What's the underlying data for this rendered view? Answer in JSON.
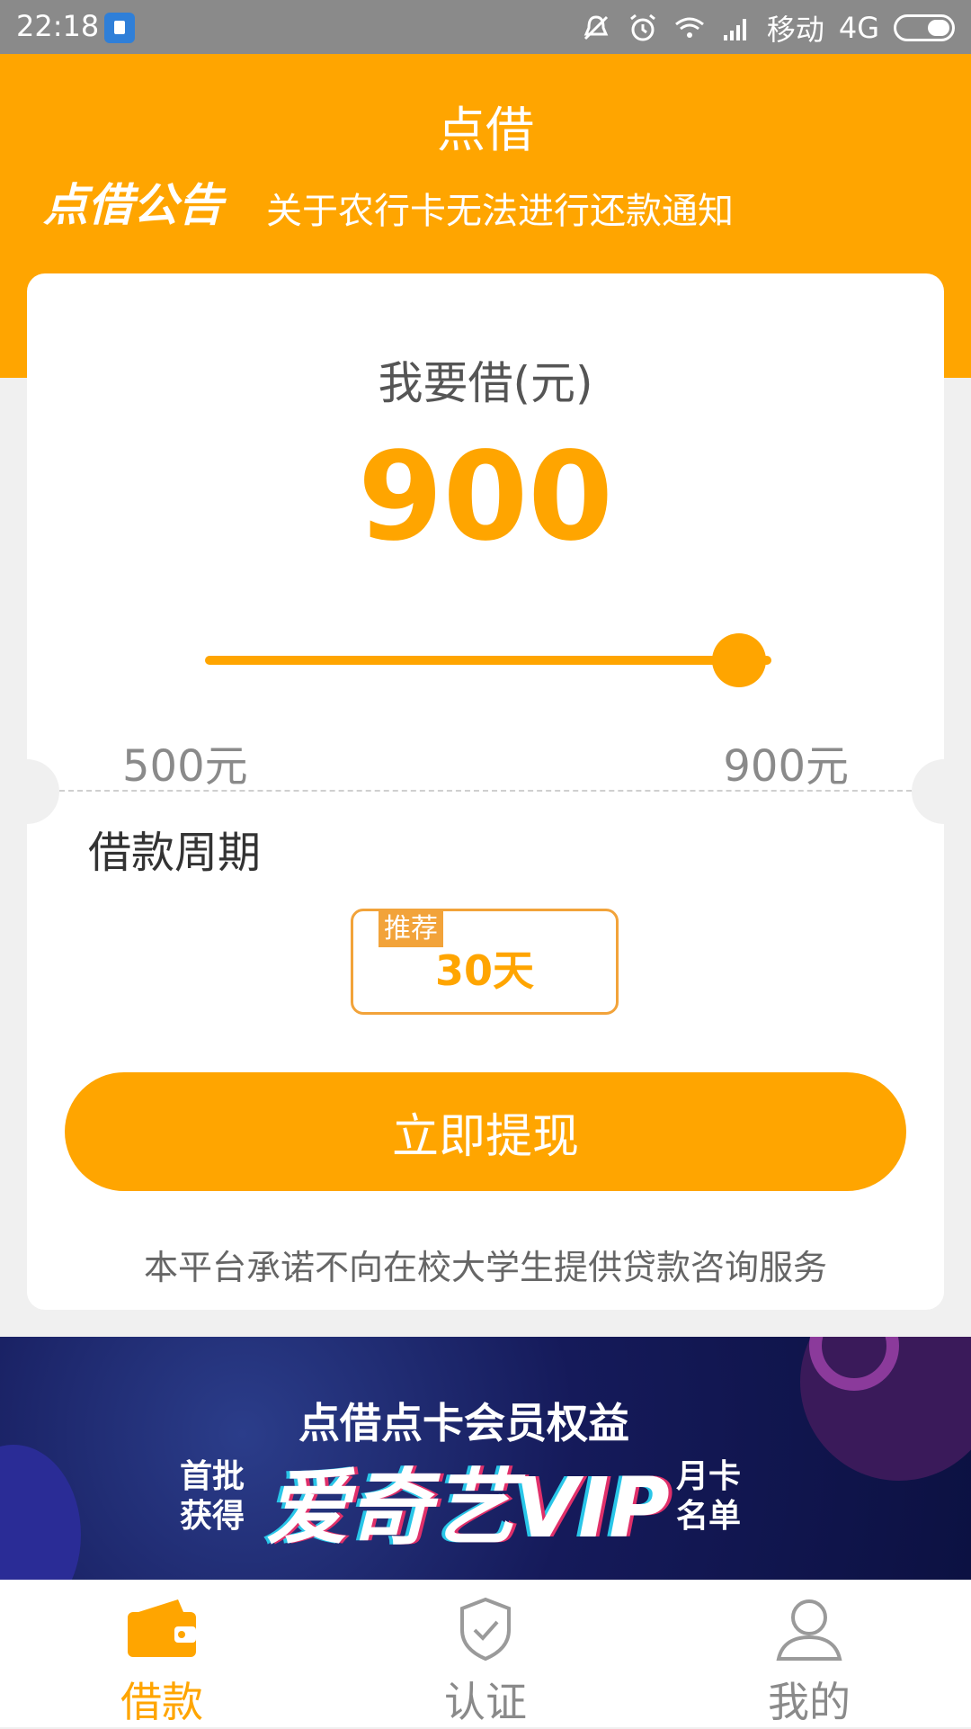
{
  "status_bar": {
    "time": "22:18",
    "carrier": "移动",
    "network": "4G",
    "icons": [
      "app-notification-icon",
      "mute-icon",
      "alarm-icon",
      "wifi-icon",
      "signal-icon",
      "battery-icon"
    ]
  },
  "header": {
    "title": "点借",
    "notice_label": "点借公告",
    "notice_text": "关于农行卡无法进行还款通知",
    "background_color": "#ffa500"
  },
  "loan_card": {
    "amount_label": "我要借(元)",
    "amount_value": "900",
    "slider": {
      "min_label": "500元",
      "max_label": "900元",
      "value_fraction": 1.0
    },
    "period_label": "借款周期",
    "period_option": {
      "tag": "推荐",
      "value": "30天"
    },
    "withdraw_button": "立即提现",
    "disclaimer": "本平台承诺不向在校大学生提供贷款咨询服务"
  },
  "banner": {
    "headline": "点借点卡会员权益",
    "left_tag": "首批获得",
    "vip_text": "爱奇艺VIP",
    "right_tag": "月卡名单"
  },
  "bottom_nav": {
    "items": [
      {
        "label": "借款",
        "icon": "wallet-icon",
        "active": true
      },
      {
        "label": "认证",
        "icon": "shield-check-icon",
        "active": false
      },
      {
        "label": "我的",
        "icon": "user-icon",
        "active": false
      }
    ],
    "active_color": "#ffa500",
    "inactive_color": "#8a8a8a"
  }
}
